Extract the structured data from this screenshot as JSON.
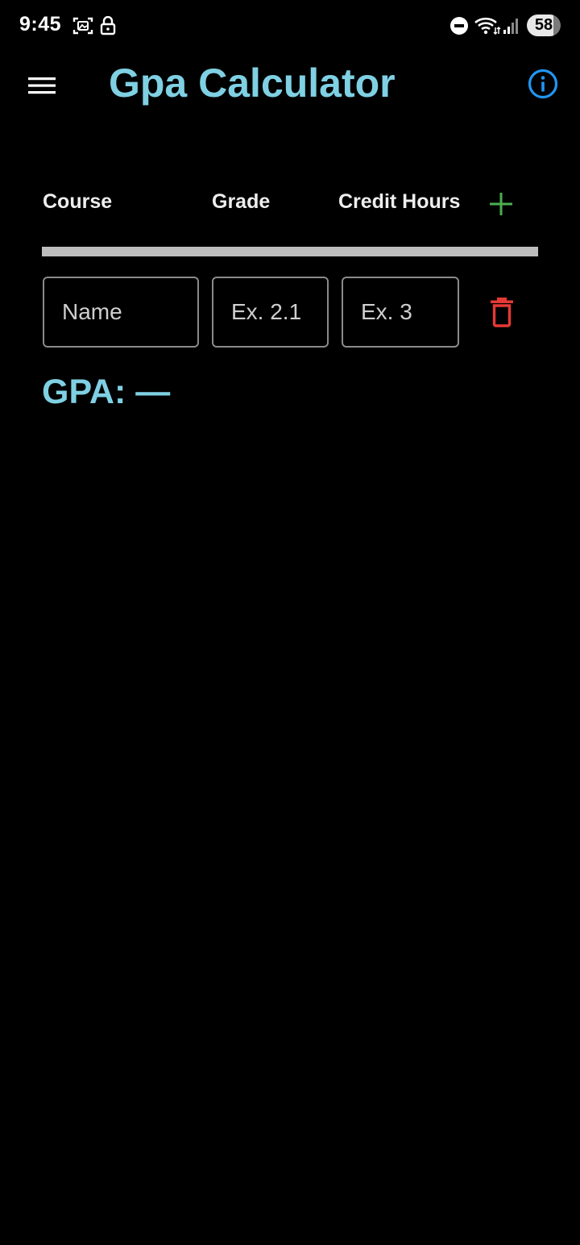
{
  "status_bar": {
    "time": "9:45",
    "battery_level": "58",
    "icons": [
      "screenshot-icon",
      "lock-icon",
      "do-not-disturb-icon",
      "wifi-icon",
      "signal-icon",
      "battery-icon"
    ]
  },
  "app_bar": {
    "title": "Gpa Calculator",
    "menu_icon": "hamburger-menu-icon",
    "info_icon": "info-icon"
  },
  "columns": {
    "course": "Course",
    "grade": "Grade",
    "credit_hours": "Credit Hours",
    "add_icon": "plus-icon"
  },
  "course_row": {
    "name_placeholder": "Name",
    "grade_placeholder": "Ex. 2.1",
    "credit_placeholder": "Ex. 3",
    "name_value": "",
    "grade_value": "",
    "credit_value": "",
    "delete_icon": "trash-icon"
  },
  "result": {
    "gpa_text": "GPA: —"
  },
  "colors": {
    "accent": "#7fd0e3",
    "info_blue": "#2196f3",
    "add_green": "#4caf50",
    "delete_red": "#e53935",
    "background": "#000000",
    "divider": "#bdbdbd"
  }
}
